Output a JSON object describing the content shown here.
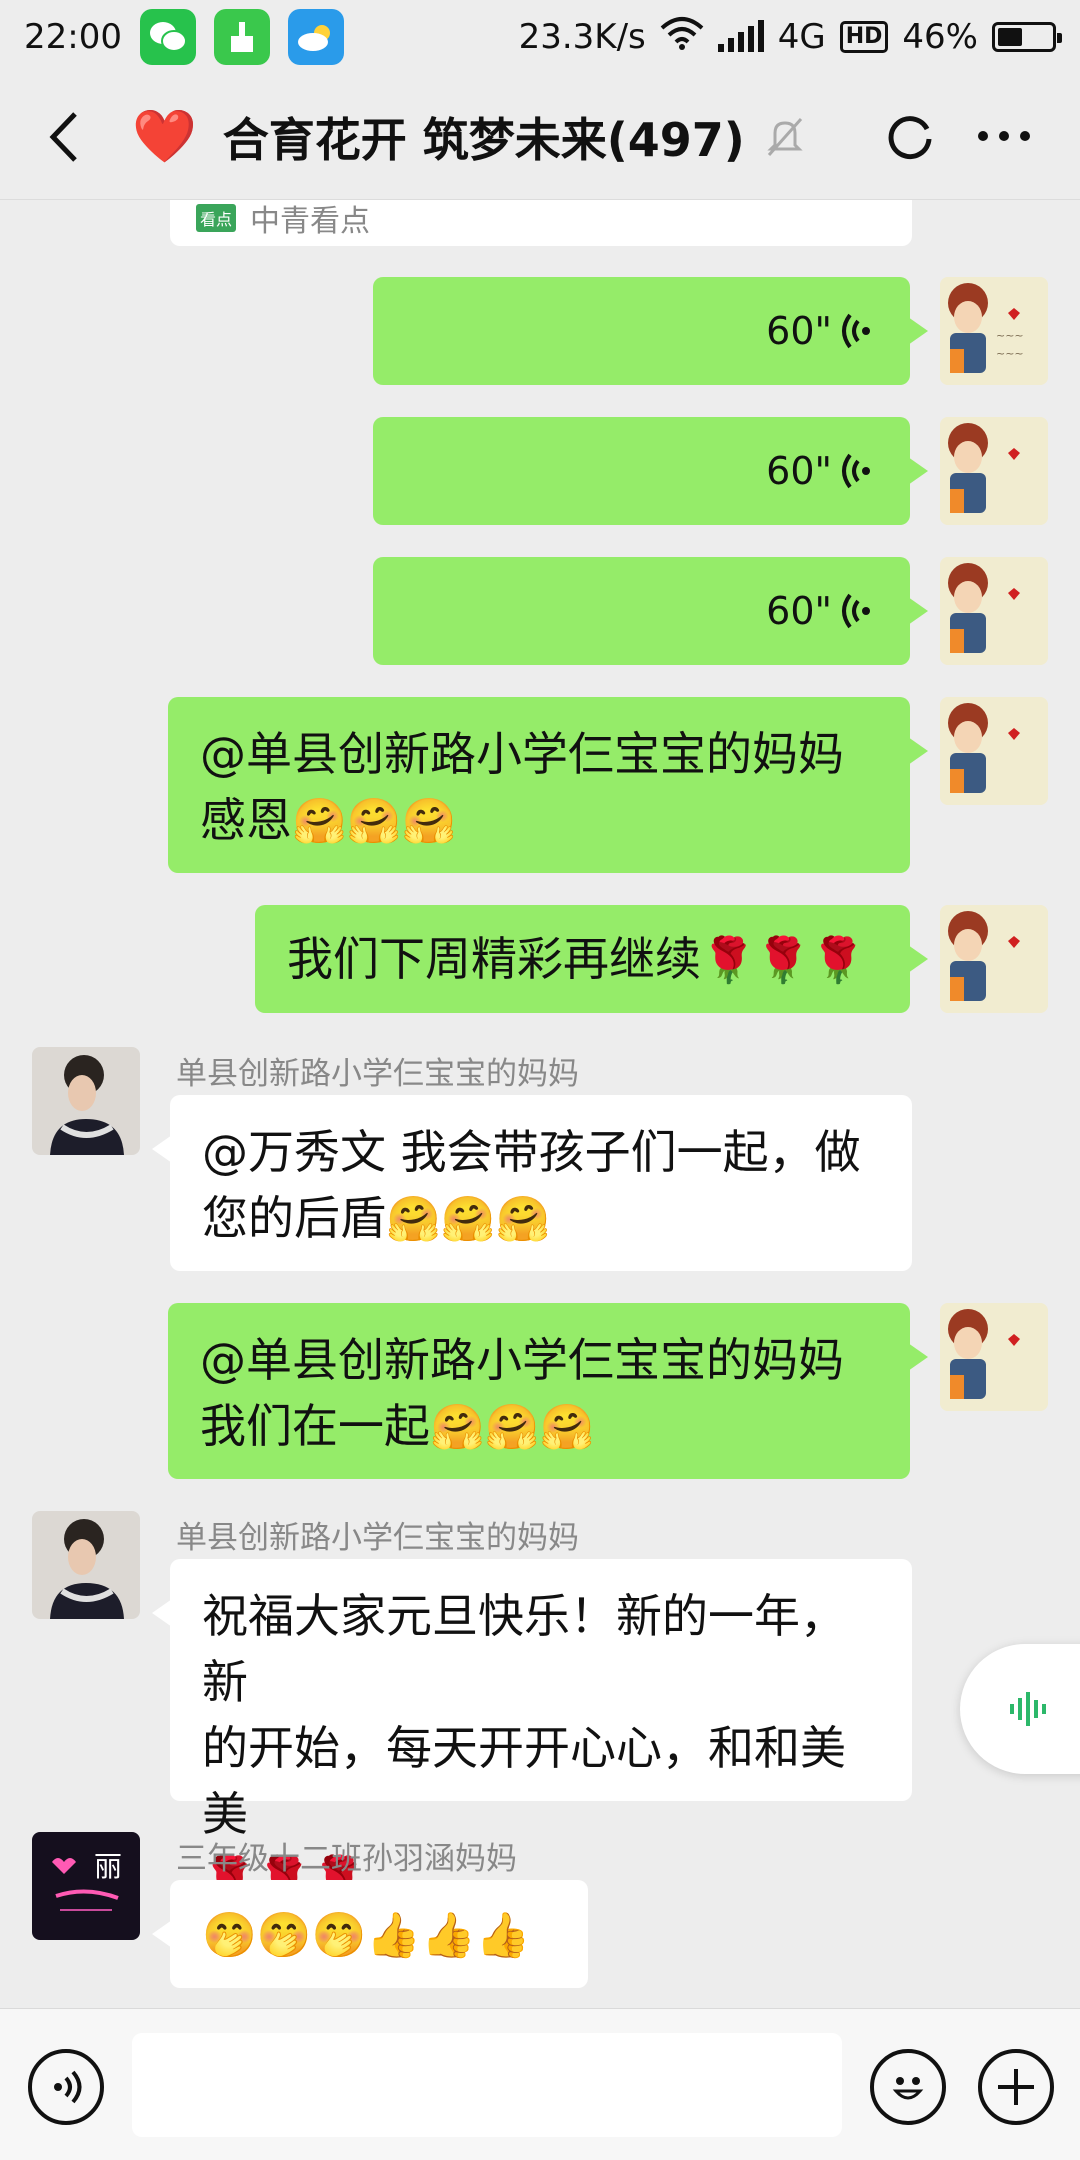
{
  "status_bar": {
    "time": "22:00",
    "network_speed": "23.3K/s",
    "network_type": "4G",
    "hd_label": "HD",
    "battery": "46%",
    "battery_level": 0.46,
    "icons": [
      "wechat-icon",
      "cleaner-icon",
      "weather-icon",
      "wifi-icon",
      "signal-icon",
      "battery-icon"
    ]
  },
  "header": {
    "title_emoji": "❤️",
    "title": "合育花开 筑梦未来(497)",
    "icons": [
      "back-icon",
      "mute-icon",
      "refresh-icon",
      "more-icon"
    ]
  },
  "partial_card": {
    "logo": "看点",
    "source": "中青看点"
  },
  "messages": [
    {
      "side": "me",
      "type": "voice",
      "duration": "60\""
    },
    {
      "side": "me",
      "type": "voice",
      "duration": "60\""
    },
    {
      "side": "me",
      "type": "voice",
      "duration": "60\""
    },
    {
      "side": "me",
      "type": "text",
      "line1": "@单县创新路小学仨宝宝的妈妈",
      "line2": "感恩",
      "emojis": "🤗🤗🤗"
    },
    {
      "side": "me",
      "type": "text",
      "line1": "我们下周精彩再继续",
      "emojis": "🌹🌹🌹"
    },
    {
      "side": "other",
      "sender": "单县创新路小学仨宝宝的妈妈",
      "type": "text",
      "line1": "@万秀文  我会带孩子们一起，做",
      "line2": "您的后盾",
      "emojis": "🤗🤗🤗"
    },
    {
      "side": "me",
      "type": "text",
      "line1": "@单县创新路小学仨宝宝的妈妈",
      "line2": "我们在一起",
      "emojis": "🤗🤗🤗"
    },
    {
      "side": "other",
      "sender": "单县创新路小学仨宝宝的妈妈",
      "type": "text",
      "line1": "祝福大家元旦快乐！新的一年，新",
      "line2": "的开始，每天开开心心，和和美美",
      "emojis": "🌹🌹🌹"
    },
    {
      "side": "other",
      "sender": "三年级十二班孙羽涵妈妈",
      "type": "text",
      "emojis": "🤭🤭🤭👍👍👍"
    }
  ],
  "avatar_text": {
    "third_sender_char": "丽"
  },
  "input_bar": {
    "placeholder": "",
    "icons": [
      "voice-mode-icon",
      "emoji-icon",
      "plus-icon"
    ]
  },
  "colors": {
    "my_bubble": "#95ec69",
    "other_bubble": "#ffffff",
    "background": "#ededed"
  }
}
